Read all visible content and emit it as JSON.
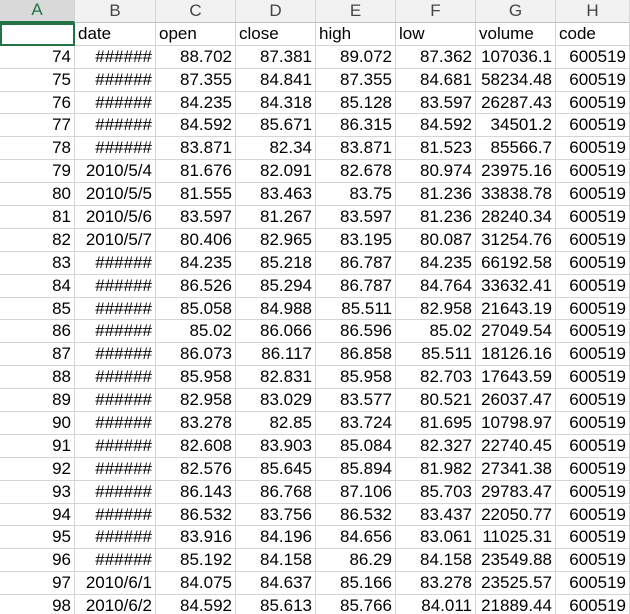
{
  "columns": [
    "A",
    "B",
    "C",
    "D",
    "E",
    "F",
    "G",
    "H"
  ],
  "header_row": [
    "",
    "date",
    "open",
    "close",
    "high",
    "low",
    "volume",
    "code"
  ],
  "rows": [
    [
      "74",
      "######",
      "88.702",
      "87.381",
      "89.072",
      "87.362",
      "107036.1",
      "600519"
    ],
    [
      "75",
      "######",
      "87.355",
      "84.841",
      "87.355",
      "84.681",
      "58234.48",
      "600519"
    ],
    [
      "76",
      "######",
      "84.235",
      "84.318",
      "85.128",
      "83.597",
      "26287.43",
      "600519"
    ],
    [
      "77",
      "######",
      "84.592",
      "85.671",
      "86.315",
      "84.592",
      "34501.2",
      "600519"
    ],
    [
      "78",
      "######",
      "83.871",
      "82.34",
      "83.871",
      "81.523",
      "85566.7",
      "600519"
    ],
    [
      "79",
      "2010/5/4",
      "81.676",
      "82.091",
      "82.678",
      "80.974",
      "23975.16",
      "600519"
    ],
    [
      "80",
      "2010/5/5",
      "81.555",
      "83.463",
      "83.75",
      "81.236",
      "33838.78",
      "600519"
    ],
    [
      "81",
      "2010/5/6",
      "83.597",
      "81.267",
      "83.597",
      "81.236",
      "28240.34",
      "600519"
    ],
    [
      "82",
      "2010/5/7",
      "80.406",
      "82.965",
      "83.195",
      "80.087",
      "31254.76",
      "600519"
    ],
    [
      "83",
      "######",
      "84.235",
      "85.218",
      "86.787",
      "84.235",
      "66192.58",
      "600519"
    ],
    [
      "84",
      "######",
      "86.526",
      "85.294",
      "86.787",
      "84.764",
      "33632.41",
      "600519"
    ],
    [
      "85",
      "######",
      "85.058",
      "84.988",
      "85.511",
      "82.958",
      "21643.19",
      "600519"
    ],
    [
      "86",
      "######",
      "85.02",
      "86.066",
      "86.596",
      "85.02",
      "27049.54",
      "600519"
    ],
    [
      "87",
      "######",
      "86.073",
      "86.117",
      "86.858",
      "85.511",
      "18126.16",
      "600519"
    ],
    [
      "88",
      "######",
      "85.958",
      "82.831",
      "85.958",
      "82.703",
      "17643.59",
      "600519"
    ],
    [
      "89",
      "######",
      "82.958",
      "83.029",
      "83.577",
      "80.521",
      "26037.47",
      "600519"
    ],
    [
      "90",
      "######",
      "83.278",
      "82.85",
      "83.724",
      "81.695",
      "10798.97",
      "600519"
    ],
    [
      "91",
      "######",
      "82.608",
      "83.903",
      "85.084",
      "82.327",
      "22740.45",
      "600519"
    ],
    [
      "92",
      "######",
      "82.576",
      "85.645",
      "85.894",
      "81.982",
      "27341.38",
      "600519"
    ],
    [
      "93",
      "######",
      "86.143",
      "86.768",
      "87.106",
      "85.703",
      "29783.47",
      "600519"
    ],
    [
      "94",
      "######",
      "86.532",
      "83.756",
      "86.532",
      "83.437",
      "22050.77",
      "600519"
    ],
    [
      "95",
      "######",
      "83.916",
      "84.196",
      "84.656",
      "83.061",
      "11025.31",
      "600519"
    ],
    [
      "96",
      "######",
      "85.192",
      "84.158",
      "86.29",
      "84.158",
      "23549.88",
      "600519"
    ],
    [
      "97",
      "2010/6/1",
      "84.075",
      "84.637",
      "85.166",
      "83.278",
      "23525.57",
      "600519"
    ],
    [
      "98",
      "2010/6/2",
      "84.592",
      "85.613",
      "85.766",
      "84.011",
      "21889.44",
      "600519"
    ]
  ]
}
